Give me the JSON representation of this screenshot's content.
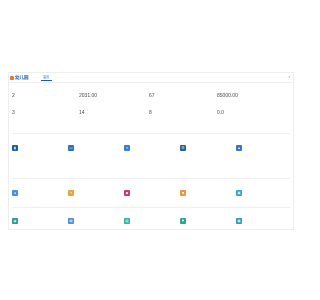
{
  "colors": {
    "brand": "#1e5aa8",
    "accent": "#e8772e",
    "nav_active": "#1e5aa8"
  },
  "header": {
    "logo_text": "幼儿园",
    "nav": [
      "首页",
      "",
      "",
      "",
      "",
      "",
      "",
      "",
      "",
      "",
      "",
      ""
    ],
    "user_text": ""
  },
  "overview": {
    "title": "",
    "subtitle": "",
    "stats": [
      {
        "label": "",
        "value": "2"
      },
      {
        "label": "",
        "value": "2031.00"
      },
      {
        "label": "",
        "value": "67"
      },
      {
        "label": "",
        "value": "85000.00"
      },
      {
        "label": "",
        "value": "3"
      },
      {
        "label": "",
        "value": "14"
      },
      {
        "label": "",
        "value": "8"
      },
      {
        "label": "",
        "value": "0.0"
      }
    ]
  },
  "sections": [
    {
      "title": "",
      "tiles": [
        {
          "icon": "person-icon",
          "color": "#1e5aa8",
          "title": "",
          "desc": ""
        },
        {
          "icon": "card-icon",
          "color": "#2f6fbf",
          "title": "",
          "desc": ""
        },
        {
          "icon": "doc-icon",
          "color": "#3b7bd1",
          "title": "",
          "desc": ""
        },
        {
          "icon": "list-icon",
          "color": "#2a5f9e",
          "title": "",
          "desc": ""
        },
        {
          "icon": "chart-icon",
          "color": "#3d72c4",
          "title": "",
          "desc": ""
        }
      ]
    },
    {
      "title": "",
      "tiles": [
        {
          "icon": "user-icon",
          "color": "#4a8fd8",
          "title": "",
          "desc": ""
        },
        {
          "icon": "note-icon",
          "color": "#e8a23a",
          "title": "",
          "desc": ""
        },
        {
          "icon": "shop-icon",
          "color": "#c0397a",
          "title": "",
          "desc": ""
        },
        {
          "icon": "gift-icon",
          "color": "#e39a3b",
          "title": "",
          "desc": ""
        },
        {
          "icon": "box-icon",
          "color": "#3a9cc8",
          "title": "",
          "desc": ""
        }
      ]
    },
    {
      "title": "",
      "tiles": [
        {
          "icon": "chat-icon",
          "color": "#2e9e8a",
          "title": "",
          "desc": ""
        },
        {
          "icon": "calendar-icon",
          "color": "#4a8fd8",
          "title": "",
          "desc": ""
        },
        {
          "icon": "image-icon",
          "color": "#2eb3a0",
          "title": "",
          "desc": ""
        },
        {
          "icon": "flag-icon",
          "color": "#27a88e",
          "title": "",
          "desc": ""
        },
        {
          "icon": "grid-icon",
          "color": "#2f9bb8",
          "title": "",
          "desc": ""
        }
      ]
    }
  ]
}
